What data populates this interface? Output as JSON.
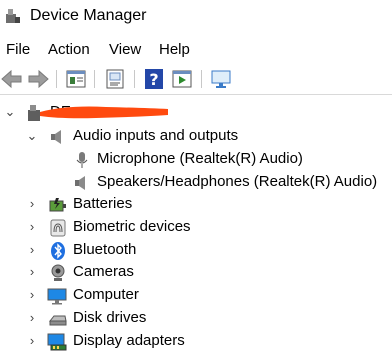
{
  "window": {
    "title": "Device Manager",
    "icon": "device-manager-icon"
  },
  "menu": [
    "File",
    "Action",
    "View",
    "Help"
  ],
  "toolbar": [
    "back-arrow-icon",
    "forward-arrow-icon",
    "properties-icon",
    "show-hidden-icon",
    "help-icon",
    "run-icon",
    "scan-hardware-icon"
  ],
  "tree": {
    "root": {
      "label": "DE",
      "icon": "computer-root-icon",
      "expanded": true
    },
    "categories": [
      {
        "label": "Audio inputs and outputs",
        "icon": "speaker-icon",
        "expanded": true,
        "children": [
          {
            "label": "Microphone (Realtek(R) Audio)",
            "icon": "microphone-icon"
          },
          {
            "label": "Speakers/Headphones (Realtek(R) Audio)",
            "icon": "speaker-icon"
          }
        ]
      },
      {
        "label": "Batteries",
        "icon": "battery-icon",
        "expanded": false
      },
      {
        "label": "Biometric devices",
        "icon": "fingerprint-icon",
        "expanded": false
      },
      {
        "label": "Bluetooth",
        "icon": "bluetooth-icon",
        "expanded": false
      },
      {
        "label": "Cameras",
        "icon": "camera-icon",
        "expanded": false
      },
      {
        "label": "Computer",
        "icon": "monitor-icon",
        "expanded": false
      },
      {
        "label": "Disk drives",
        "icon": "disk-drive-icon",
        "expanded": false
      },
      {
        "label": "Display adapters",
        "icon": "display-adapter-icon",
        "expanded": false
      }
    ]
  },
  "colors": {
    "redaction": "#ff4a0f",
    "bluetooth": "#1f6fe0",
    "monitor": "#1e88e5"
  }
}
